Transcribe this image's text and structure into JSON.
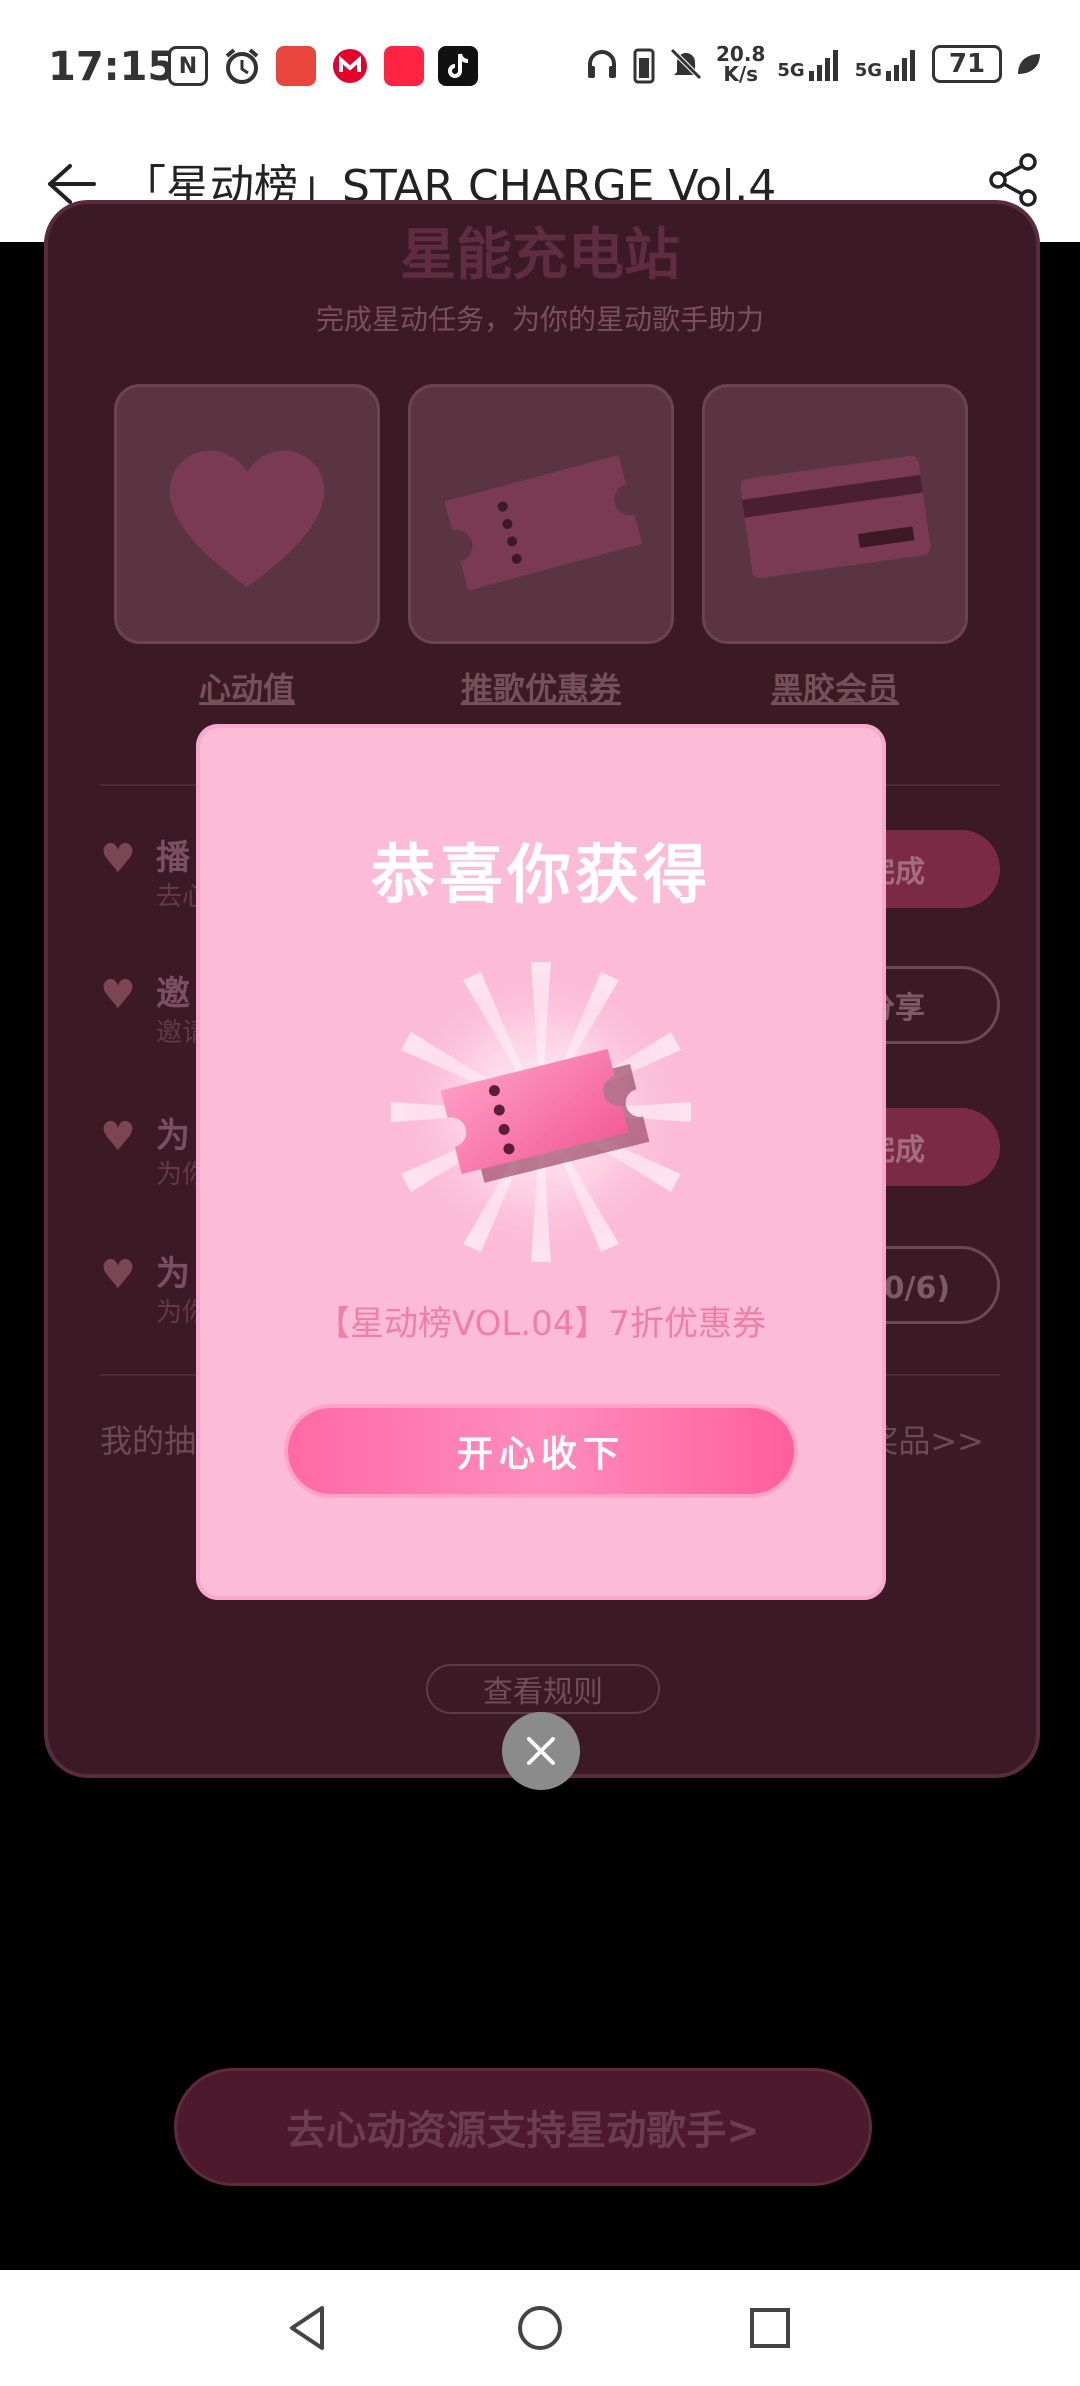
{
  "status_bar": {
    "time": "17:15",
    "net_speed_value": "20.8",
    "net_speed_unit": "K/s",
    "signal1": "5G",
    "signal2": "5G",
    "battery": "71"
  },
  "header": {
    "title": "「星动榜」STAR CHARGE Vol.4"
  },
  "background": {
    "section_title": "星能充电站",
    "section_subtitle": "完成星动任务，为你的星动歌手助力",
    "rewards": [
      {
        "label": "心动值"
      },
      {
        "label": "推歌优惠券"
      },
      {
        "label": "黑胶会员"
      }
    ],
    "tasks": [
      {
        "title": "播",
        "desc": "去心",
        "button": "完成"
      },
      {
        "title": "邀",
        "desc": "邀请",
        "button": "分享"
      },
      {
        "title": "为",
        "desc": "为你",
        "button": "完成"
      },
      {
        "title": "为",
        "desc": "为你",
        "button": "力(0/6)"
      }
    ],
    "footer_left": "我的抽",
    "footer_right": "奖品>>",
    "rules_button": "查看规则",
    "bottom_cta": "去心动资源支持星动歌手>"
  },
  "modal": {
    "title": "恭喜你获得",
    "prize": "【星动榜VOL.04】7折优惠券",
    "accept_button": "开心收下"
  },
  "colors": {
    "modal_bg": "#fcbcd8",
    "accent_pink": "#ff69a4",
    "panel_bg": "#3b1a25"
  }
}
